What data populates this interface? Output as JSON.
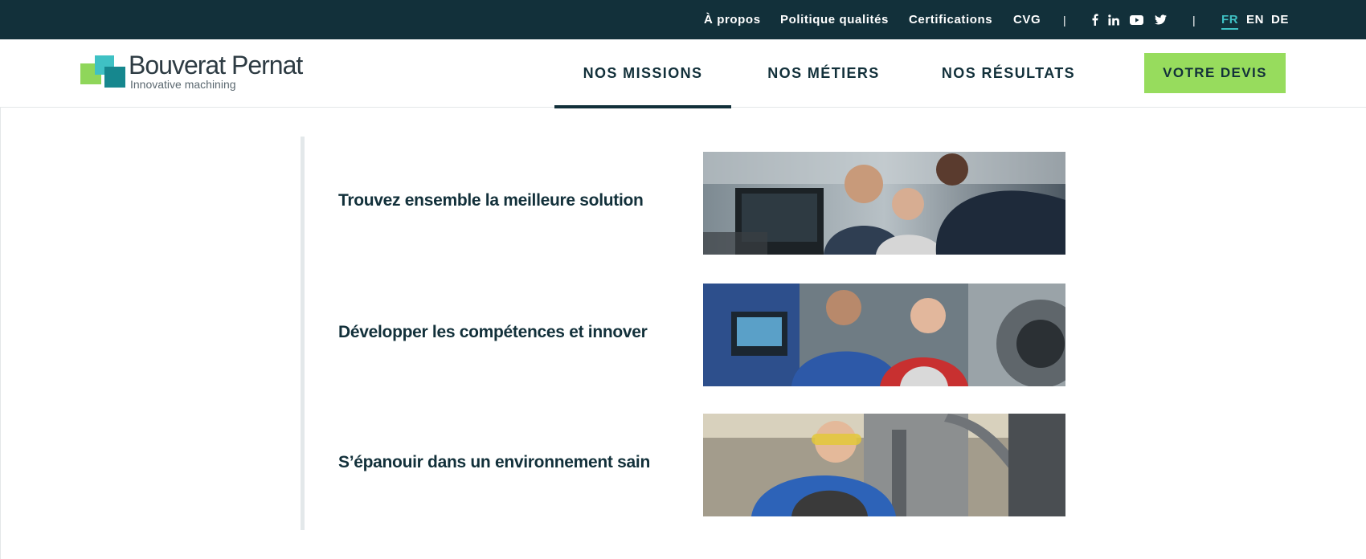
{
  "topbar": {
    "links": [
      "À propos",
      "Politique qualités",
      "Certifications",
      "CVG"
    ],
    "separator": "|",
    "social_icons": [
      "facebook-icon",
      "linkedin-icon",
      "youtube-icon",
      "twitter-icon"
    ],
    "languages": [
      "FR",
      "EN",
      "DE"
    ],
    "active_language": "FR"
  },
  "header": {
    "logo_name": "Bouverat Pernat",
    "logo_tagline": "Innovative machining",
    "nav": [
      "NOS MISSIONS",
      "NOS MÉTIERS",
      "NOS RÉSULTATS"
    ],
    "active_nav": "NOS MISSIONS",
    "cta_label": "VOTRE DEVIS"
  },
  "sections": [
    {
      "title": "Trouvez ensemble la meilleure solution"
    },
    {
      "title": "Développer les compétences et innover"
    },
    {
      "title": "S’épanouir dans un environnement sain"
    }
  ],
  "colors": {
    "dark": "#12303a",
    "accent_green": "#97dc5d",
    "accent_teal": "#3fc1c4",
    "logo_teal_dark": "#16878e"
  }
}
